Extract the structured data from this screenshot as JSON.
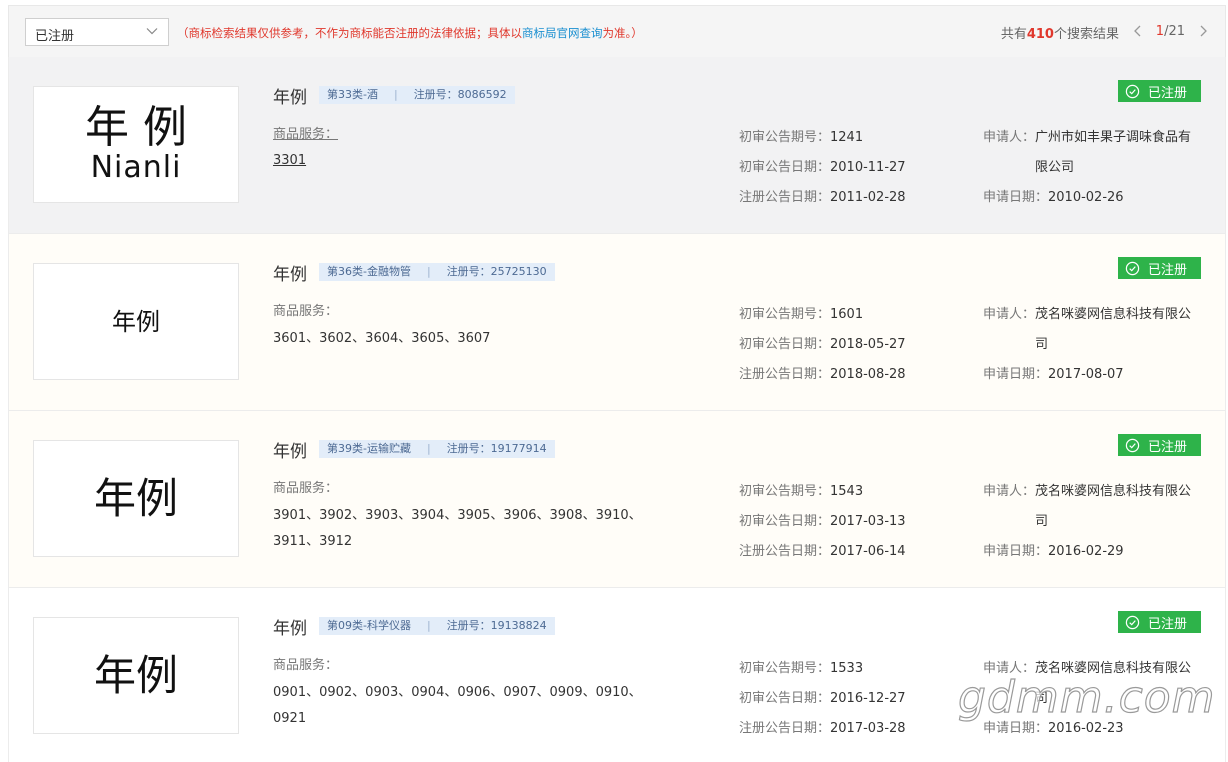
{
  "filter": {
    "selected": "已注册"
  },
  "disclaimer": {
    "prefix": "（商标检索结果仅供参考，不作为商标能否注册的法律依据；具体以",
    "link": "商标局官网查询",
    "suffix": "为准。）"
  },
  "summary": {
    "prefix": "共有",
    "count": "410",
    "suffix": "个搜索结果"
  },
  "pagination": {
    "current": "1",
    "total": "/21"
  },
  "labels": {
    "services": "商品服务：",
    "prelim_no": "初审公告期号：",
    "prelim_date": "初审公告日期：",
    "reg_date": "注册公告日期：",
    "applicant": "申请人：",
    "apply_date": "申请日期："
  },
  "results": [
    {
      "name": "年例",
      "logo_zh": "年 例",
      "logo_en": "Nianli",
      "category": "第33类-酒",
      "reg_no": "注册号：8086592",
      "services": "3301",
      "prelim_no": "1241",
      "prelim_date": "2010-11-27",
      "reg_date": "2011-02-28",
      "applicant": "广州市如丰果子调味食品有限公司",
      "apply_date": "2010-02-26",
      "status": "已注册"
    },
    {
      "name": "年例",
      "logo_zh": "年例",
      "category": "第36类-金融物管",
      "reg_no": "注册号：25725130",
      "services": "3601、3602、3604、3605、3607",
      "prelim_no": "1601",
      "prelim_date": "2018-05-27",
      "reg_date": "2018-08-28",
      "applicant": "茂名咪婆网信息科技有限公司",
      "apply_date": "2017-08-07",
      "status": "已注册"
    },
    {
      "name": "年例",
      "logo_zh": "年例",
      "category": "第39类-运输贮藏",
      "reg_no": "注册号：19177914",
      "services": "3901、3902、3903、3904、3905、3906、3908、3910、3911、3912",
      "prelim_no": "1543",
      "prelim_date": "2017-03-13",
      "reg_date": "2017-06-14",
      "applicant": "茂名咪婆网信息科技有限公司",
      "apply_date": "2016-02-29",
      "status": "已注册"
    },
    {
      "name": "年例",
      "logo_zh": "年例",
      "category": "第09类-科学仪器",
      "reg_no": "注册号：19138824",
      "services": "0901、0902、0903、0904、0906、0907、0909、0910、0921",
      "prelim_no": "1533",
      "prelim_date": "2016-12-27",
      "reg_date": "2017-03-28",
      "applicant": "茂名咪婆网信息科技有限公司",
      "apply_date": "2016-02-23",
      "status": "已注册"
    }
  ],
  "watermark": "gdmm.com"
}
